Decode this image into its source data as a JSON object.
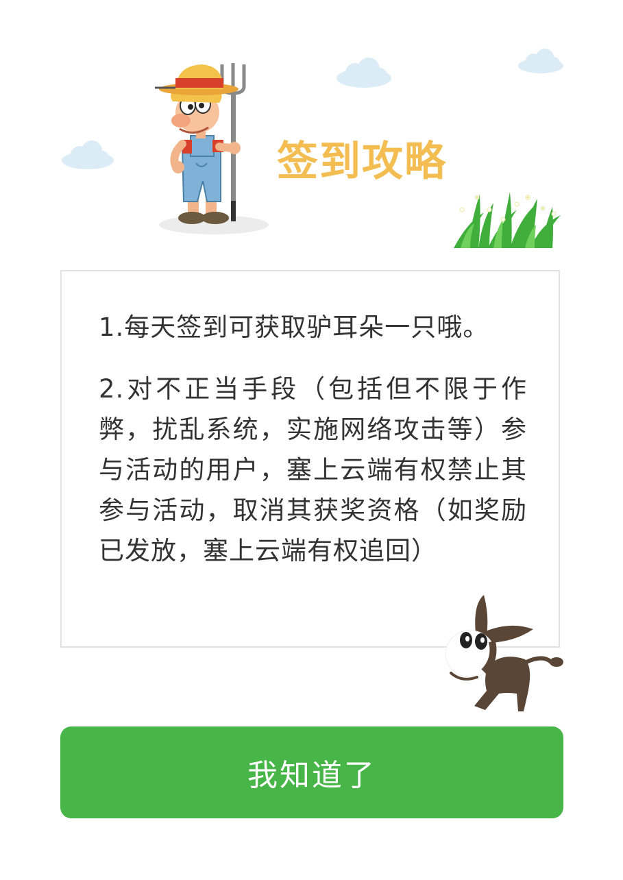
{
  "colors": {
    "title": "#f3bd52",
    "button_bg": "#48b548",
    "button_text": "#ffffff",
    "rule_text": "#333333",
    "cloud": "#dcecf6",
    "border": "#e2e2e2"
  },
  "icons": {
    "farmer": "farmer-with-pitchfork-illustration",
    "grass": "grass-with-daisies-illustration",
    "donkey": "donkey-mascot-illustration",
    "cloud": "cloud-icon"
  },
  "header": {
    "title": "签到攻略"
  },
  "rules": [
    "1.每天签到可获取驴耳朵一只哦。",
    "2.对不正当手段（包括但不限于作弊，扰乱系统，实施网络攻击等）参与活动的用户，塞上云端有权禁止其参与活动，取消其获奖资格（如奖励已发放，塞上云端有权追回）"
  ],
  "button": {
    "label": "我知道了"
  }
}
